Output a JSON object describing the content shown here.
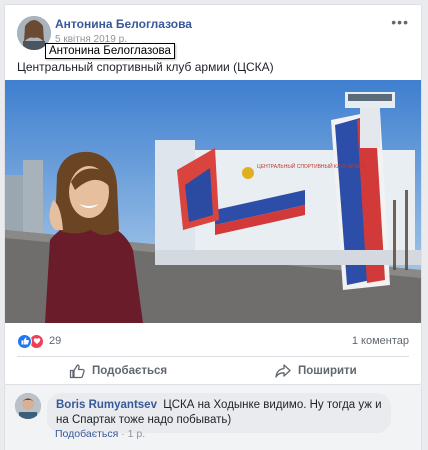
{
  "post": {
    "author": "Антонина Белоглазова",
    "date": "5 квітня 2019 р.",
    "tooltip": "Антонина Белоглазова",
    "more_icon": "•••",
    "text": "Центральный спортивный клуб армии (ЦСКА)",
    "photo_sign": "ЦЕНТРАЛЬНЫЙ СПОРТИВНЫЙ КЛУБ АРМИИ"
  },
  "reactions": {
    "count": "29",
    "comments_count": "1 коментар",
    "like_icon": "thumbs-up-icon",
    "love_icon": "heart-icon"
  },
  "actions": {
    "like": "Подобається",
    "share": "Поширити"
  },
  "comment": {
    "author": "Boris Rumyantsev",
    "text": "ЦСКА на Ходынке видимо. Ну тогда уж и на Спартак тоже надо побывать)",
    "like": "Подобається",
    "separator": "·",
    "time": "1 р."
  },
  "colors": {
    "link": "#385898",
    "like_blue": "#2078f4",
    "love_red": "#f33e58",
    "muted": "#606770"
  }
}
